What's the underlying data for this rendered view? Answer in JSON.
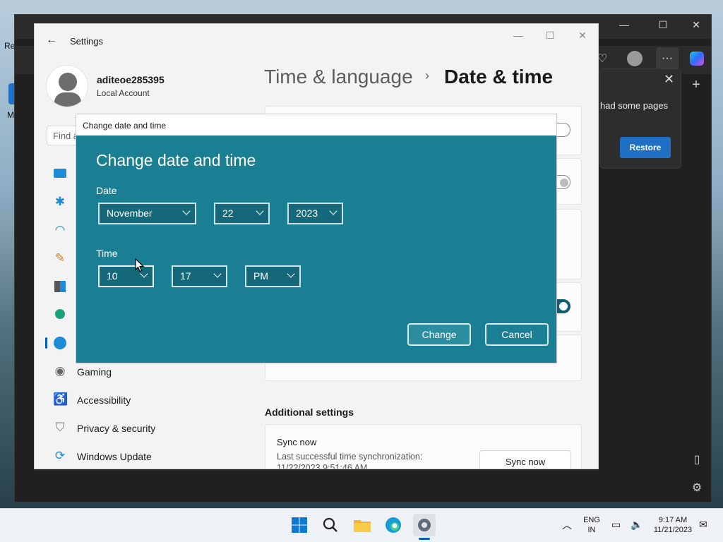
{
  "desktop": {
    "left_label_1": "Re",
    "left_label_2": "M"
  },
  "edge": {
    "restore_message": "had some pages",
    "restore_button": "Restore",
    "toolbar_more": "···"
  },
  "settings": {
    "window_title": "Settings",
    "user": {
      "name": "aditeoe285395",
      "account_type": "Local Account"
    },
    "search_placeholder": "Find a",
    "breadcrumb": {
      "parent": "Time & language",
      "separator": "›",
      "current": "Date & time"
    },
    "nav": [
      {
        "label": "Gaming",
        "icon": "gaming-icon"
      },
      {
        "label": "Accessibility",
        "icon": "accessibility-icon"
      },
      {
        "label": "Privacy & security",
        "icon": "shield-icon"
      },
      {
        "label": "Windows Update",
        "icon": "windows-update-icon"
      }
    ],
    "additional_settings_title": "Additional settings",
    "sync": {
      "title": "Sync now",
      "subtitle": "Last successful time synchronization: 11/22/2023 9:51:46 AM",
      "button": "Sync now"
    }
  },
  "dialog": {
    "window_title": "Change date and time",
    "heading": "Change date and time",
    "date_label": "Date",
    "month": "November",
    "day": "22",
    "year": "2023",
    "time_label": "Time",
    "hour": "10",
    "minute": "17",
    "ampm": "PM",
    "change_button": "Change",
    "cancel_button": "Cancel"
  },
  "taskbar": {
    "language_line1": "ENG",
    "language_line2": "IN",
    "time": "9:17 AM",
    "date": "11/21/2023"
  },
  "colors": {
    "dialog_bg": "#1a7f92",
    "accent": "#005fb8",
    "restore_button": "#1f6fc4"
  }
}
